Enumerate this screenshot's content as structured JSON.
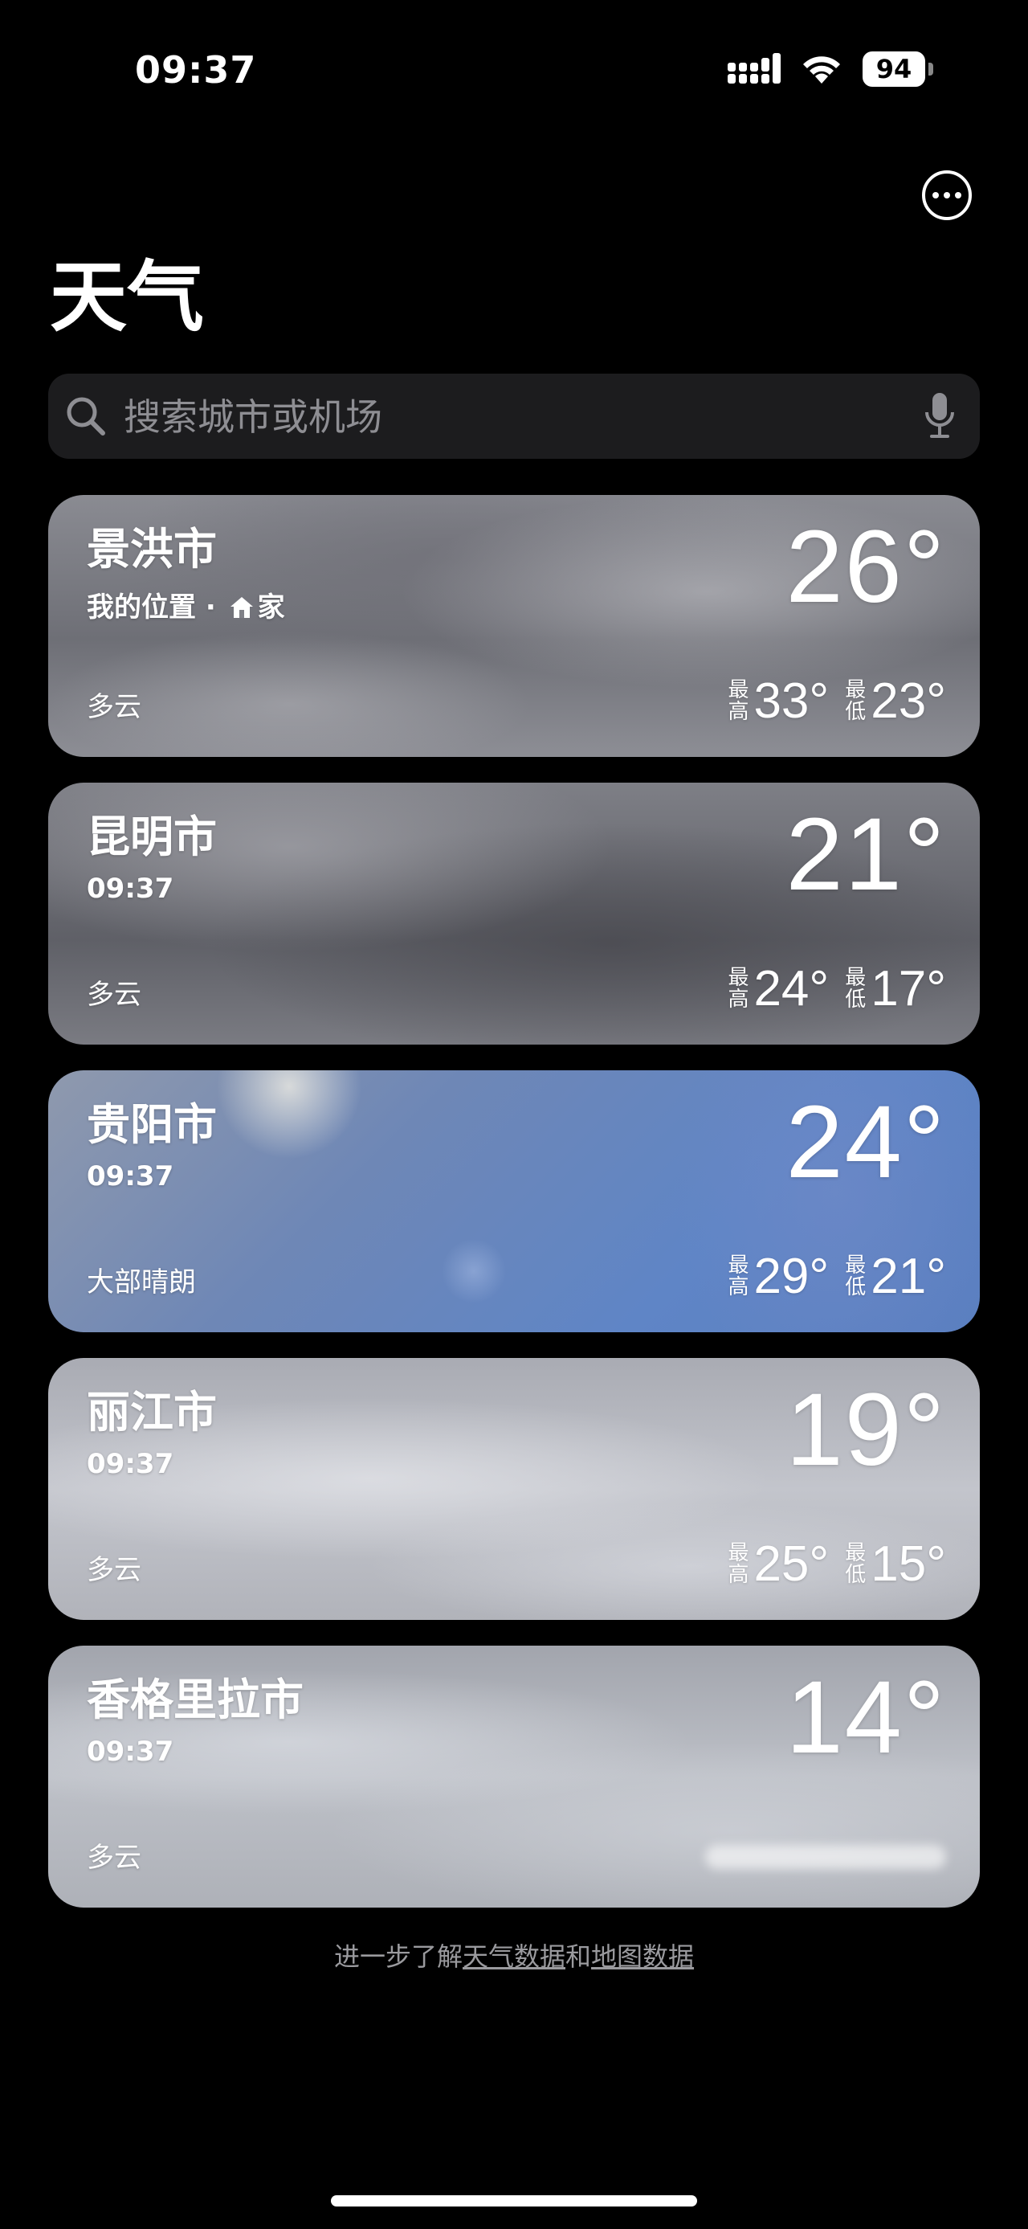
{
  "status_bar": {
    "time": "09:37",
    "battery": "94"
  },
  "header": {
    "title": "天气",
    "more_icon": "ellipsis-circle-icon"
  },
  "search": {
    "placeholder": "搜索城市或机场",
    "icons": [
      "search-icon",
      "microphone-icon"
    ]
  },
  "cards": [
    {
      "city": "景洪市",
      "subtitle_location": "我的位置",
      "subtitle_home": "家",
      "temp": "26°",
      "condition": "多云",
      "hi_label": [
        "最",
        "高"
      ],
      "high": "33°",
      "lo_label": [
        "最",
        "低"
      ],
      "low": "23°",
      "style": "cloudy-dark"
    },
    {
      "city": "昆明市",
      "subtitle": "09:37",
      "temp": "21°",
      "condition": "多云",
      "hi_label": [
        "最",
        "高"
      ],
      "high": "24°",
      "lo_label": [
        "最",
        "低"
      ],
      "low": "17°",
      "style": "cloudy-darker"
    },
    {
      "city": "贵阳市",
      "subtitle": "09:37",
      "temp": "24°",
      "condition": "大部晴朗",
      "hi_label": [
        "最",
        "高"
      ],
      "high": "29°",
      "lo_label": [
        "最",
        "低"
      ],
      "low": "21°",
      "style": "sunny"
    },
    {
      "city": "丽江市",
      "subtitle": "09:37",
      "temp": "19°",
      "condition": "多云",
      "hi_label": [
        "最",
        "高"
      ],
      "high": "25°",
      "lo_label": [
        "最",
        "低"
      ],
      "low": "15°",
      "style": "cloudy-light"
    },
    {
      "city": "香格里拉市",
      "subtitle": "09:37",
      "temp": "14°",
      "condition": "多云",
      "style": "cloudy-pale"
    }
  ],
  "footer": {
    "prefix": "进一步了解",
    "link1": "天气数据",
    "middle": "和",
    "link2": "地图数据"
  }
}
